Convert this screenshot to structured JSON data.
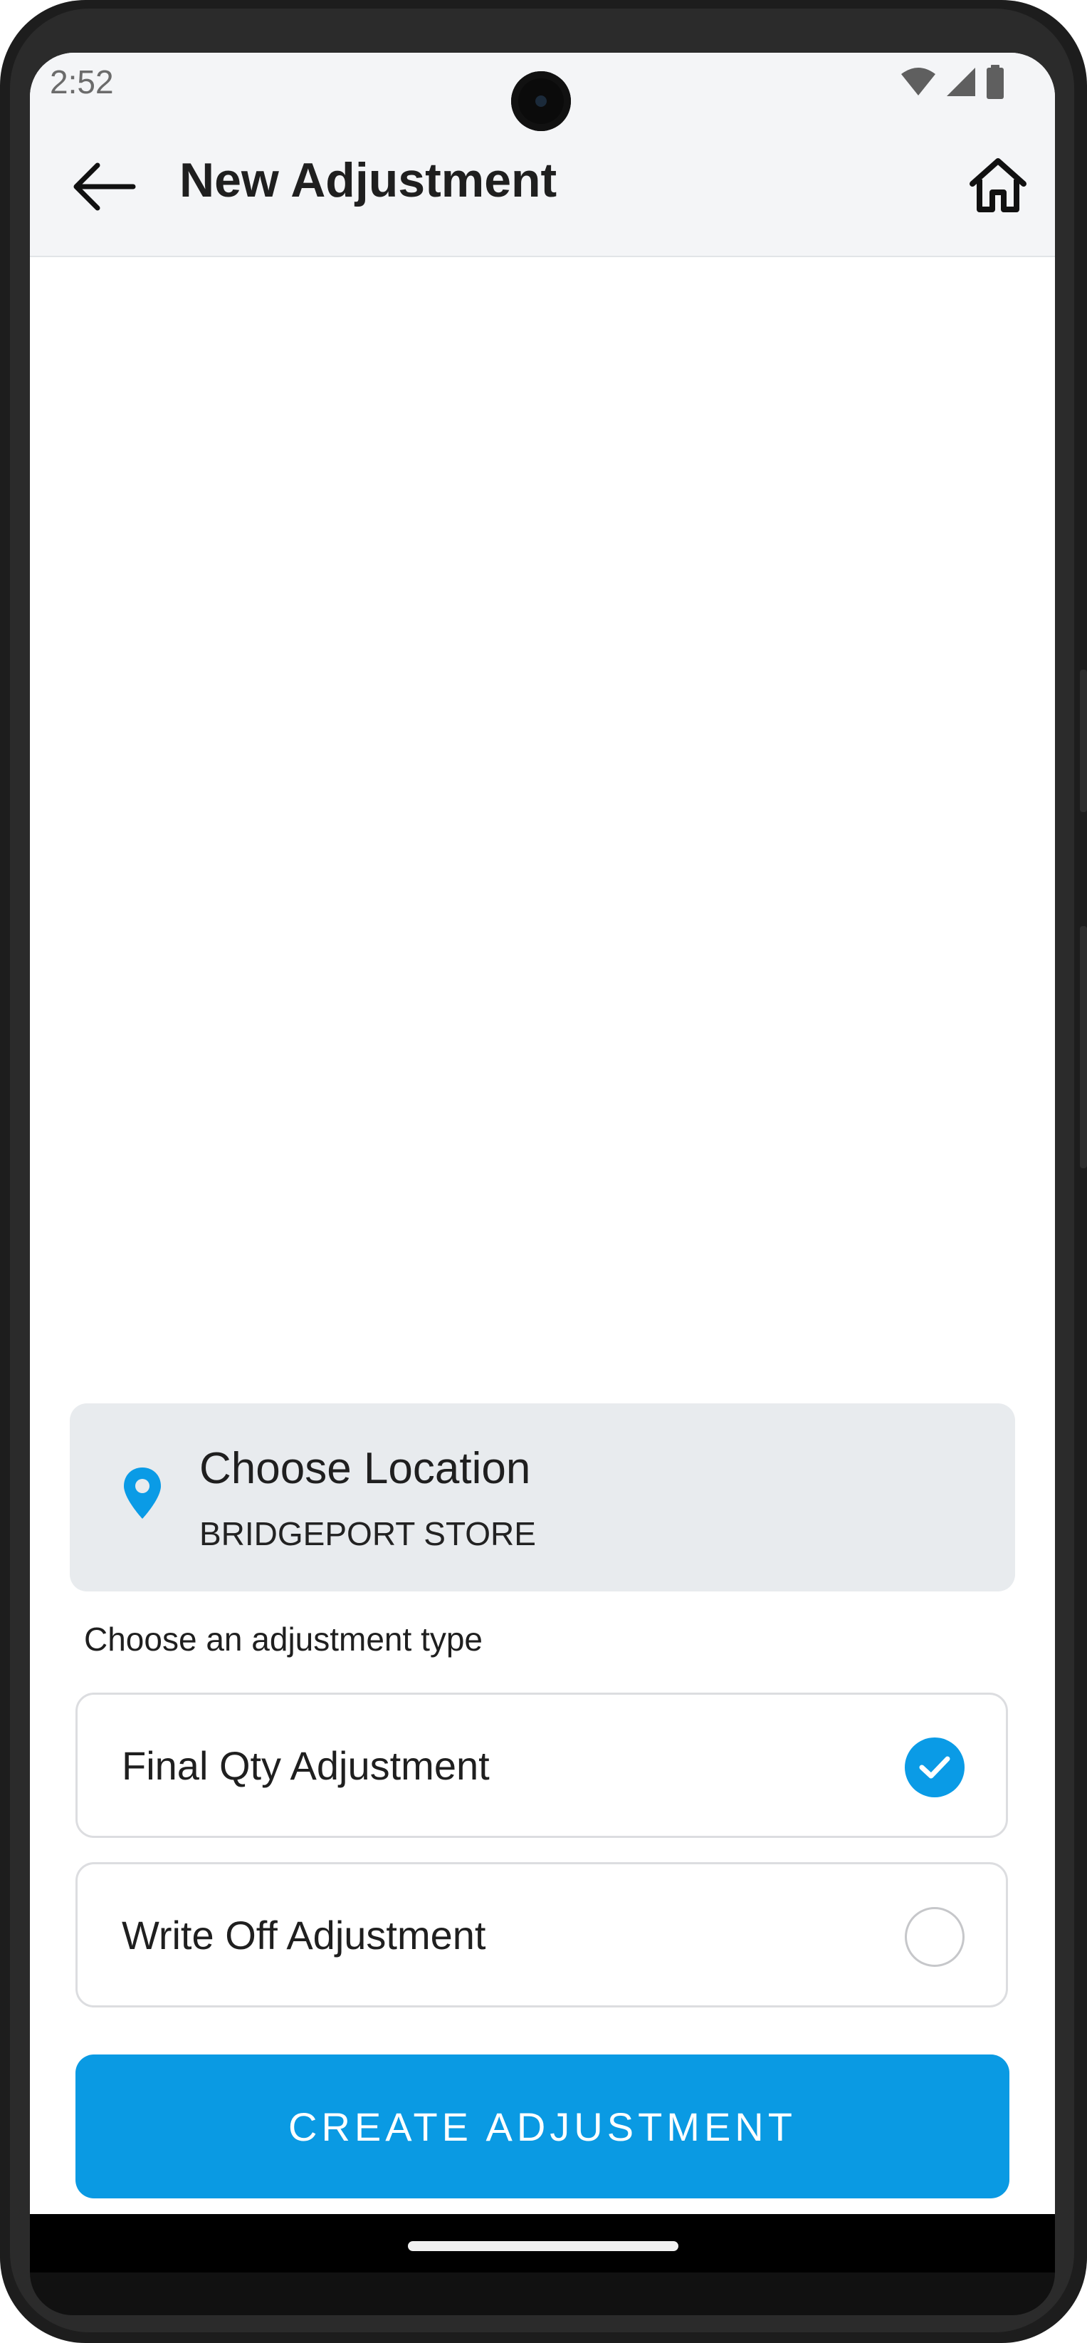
{
  "status_bar": {
    "time": "2:52",
    "icons": [
      "wifi-icon",
      "signal-icon",
      "battery-icon"
    ]
  },
  "toolbar": {
    "title": "New Adjustment",
    "back_icon": "arrow-left-icon",
    "home_icon": "home-icon"
  },
  "location": {
    "title": "Choose Location",
    "value": "BRIDGEPORT STORE",
    "icon": "location-pin-icon",
    "icon_color": "#0a9be6"
  },
  "adjustment": {
    "section_label": "Choose an adjustment type",
    "options": [
      {
        "label": "Final Qty Adjustment",
        "selected": true
      },
      {
        "label": "Write Off Adjustment",
        "selected": false
      }
    ]
  },
  "actions": {
    "create_label": "CREATE ADJUSTMENT"
  },
  "colors": {
    "accent": "#0a9ae3",
    "header_bg": "#f4f5f7",
    "card_bg": "#e8ebee"
  }
}
